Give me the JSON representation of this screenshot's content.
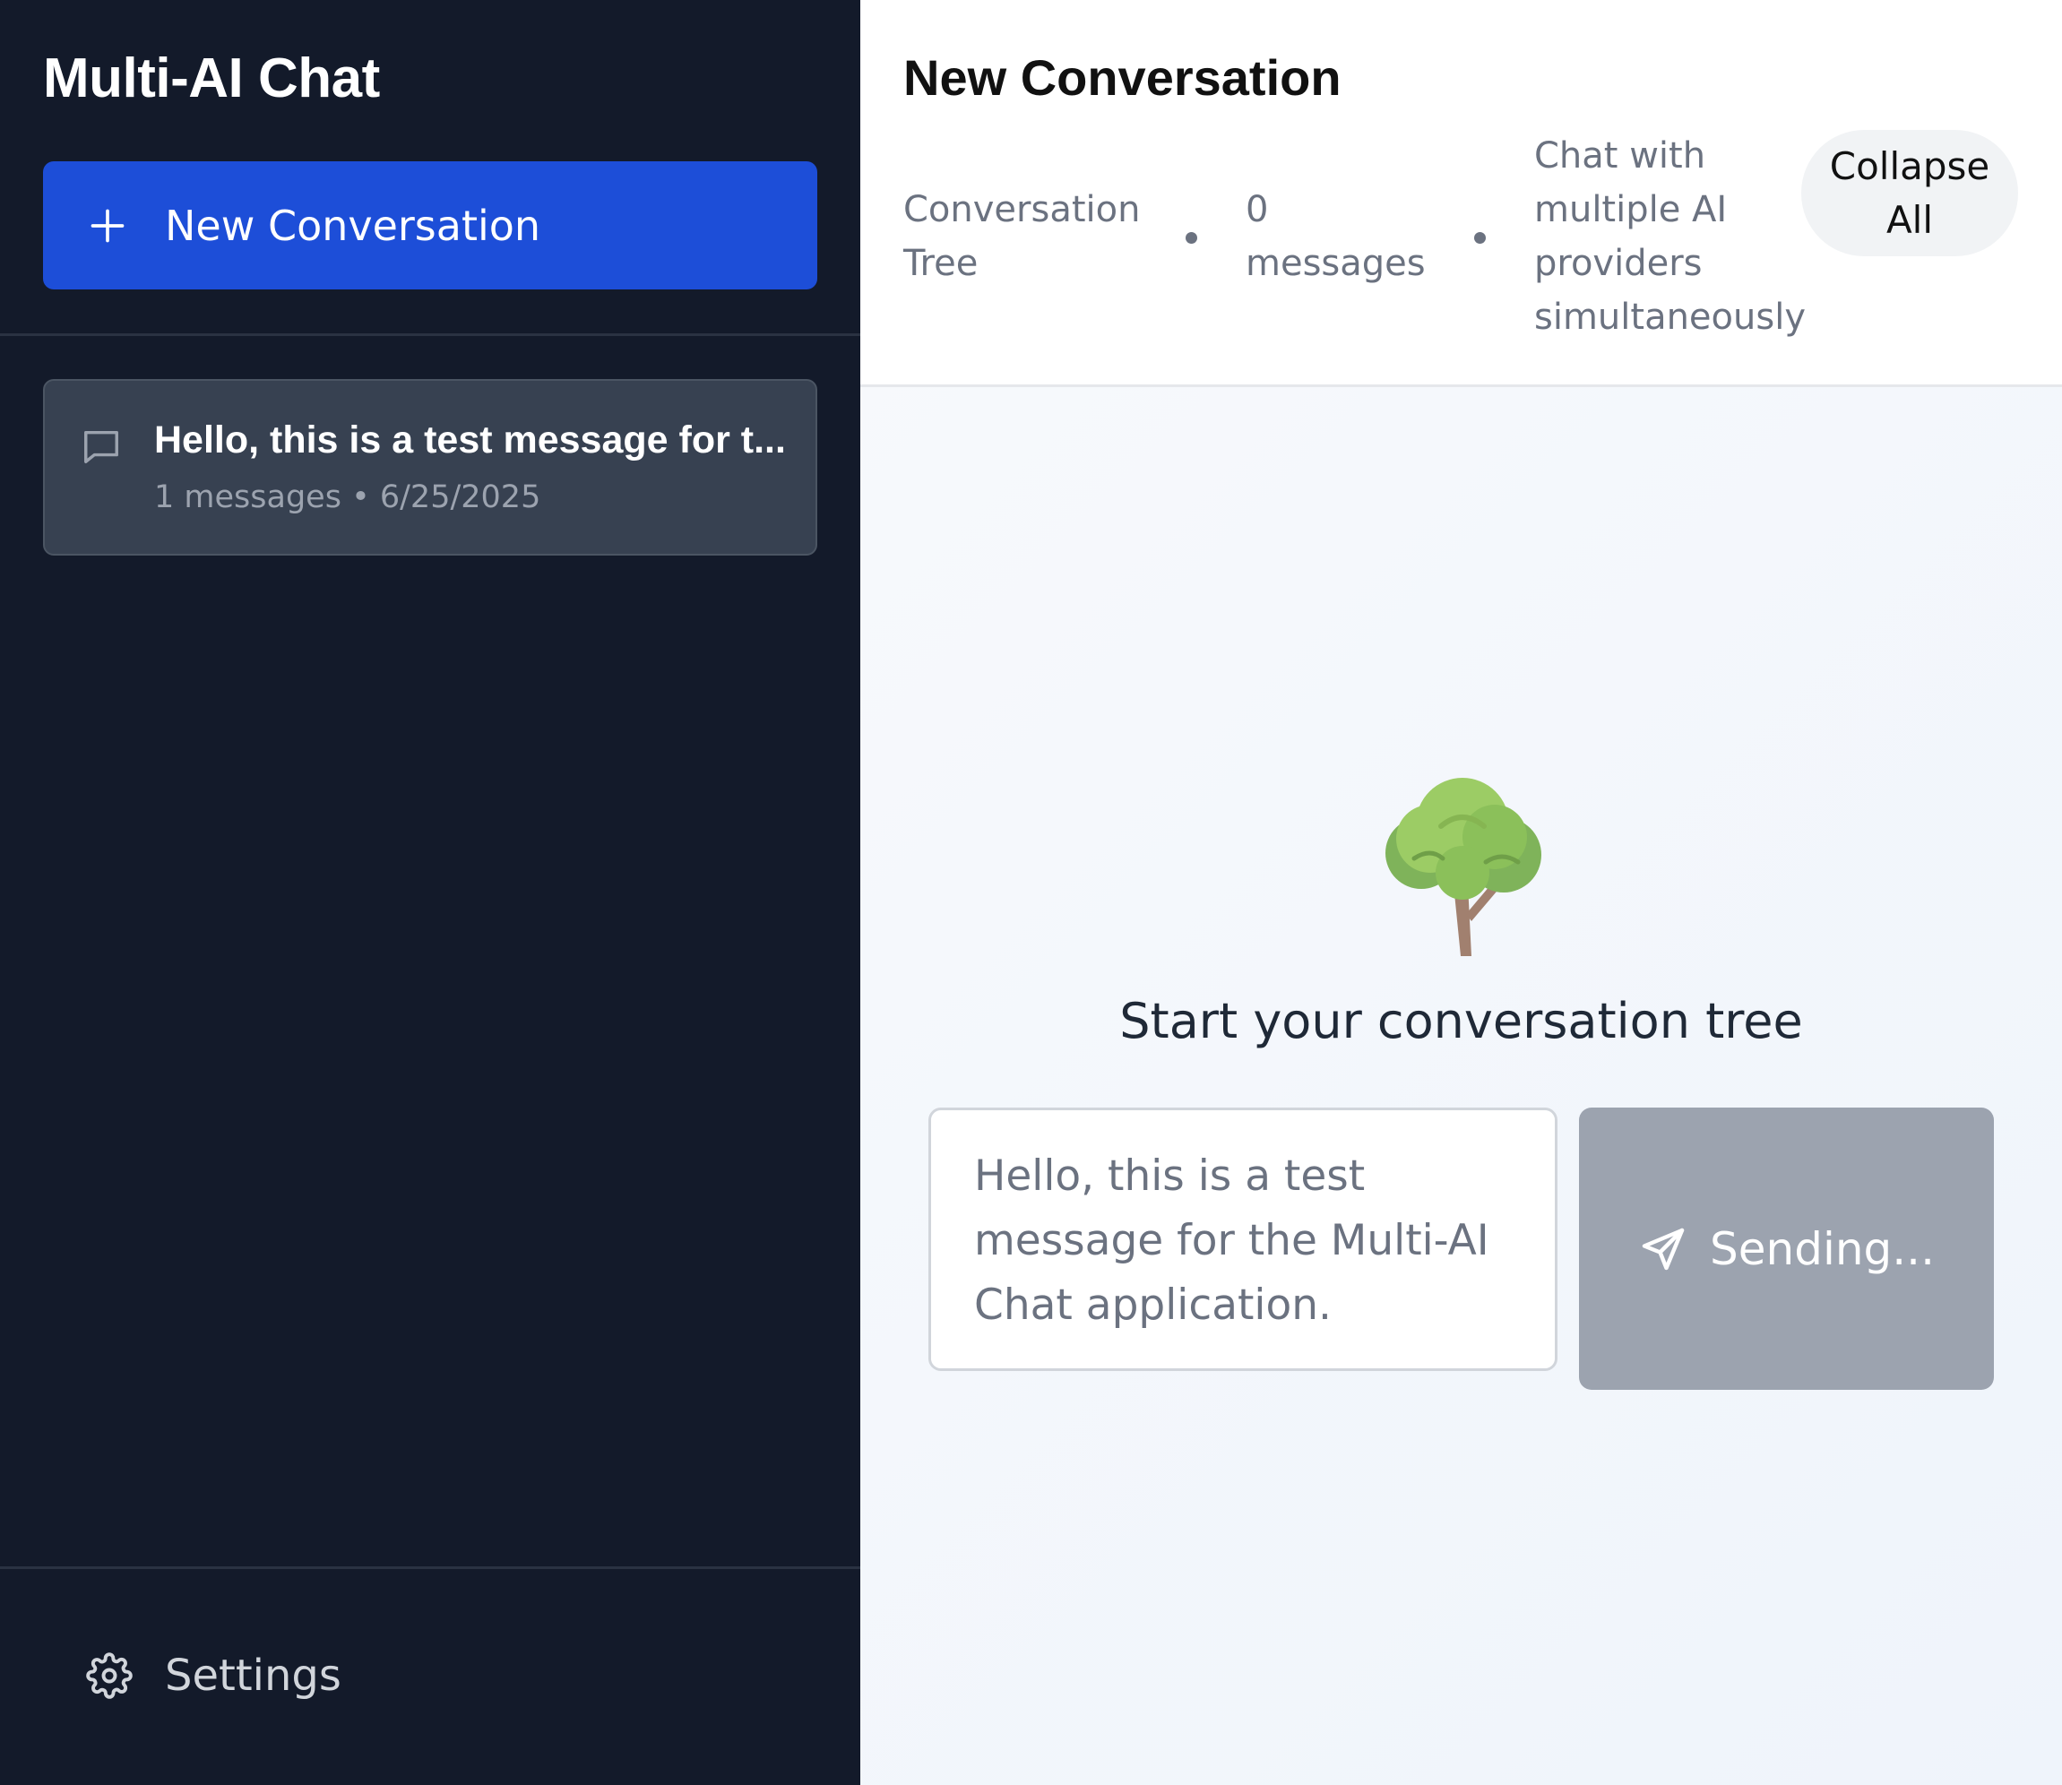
{
  "sidebar": {
    "app_title": "Multi-AI Chat",
    "new_conversation_label": "New Conversation",
    "conversations": [
      {
        "title": "Hello, this is a test message for t...",
        "message_count": "1 messages",
        "separator": "•",
        "date": "6/25/2025"
      }
    ],
    "settings_label": "Settings"
  },
  "header": {
    "title": "New Conversation",
    "view_mode": "Conversation Tree",
    "message_count": "0 messages",
    "description": "Chat with multiple AI providers simultaneously",
    "collapse_all_label": "Collapse All"
  },
  "empty_state": {
    "emoji": "🌳",
    "title": "Start your conversation tree"
  },
  "composer": {
    "input_value": "Hello, this is a test message for the Multi-AI Chat application.",
    "send_label": "Sending..."
  },
  "colors": {
    "sidebar_bg": "#131a2a",
    "accent": "#1d4ed8",
    "conversation_item_bg": "#374151",
    "send_disabled": "#9ca3af"
  },
  "icons": {
    "new_conversation": "plus-icon",
    "conversation": "chat-bubble-icon",
    "settings": "gear-icon",
    "send": "send-icon"
  }
}
